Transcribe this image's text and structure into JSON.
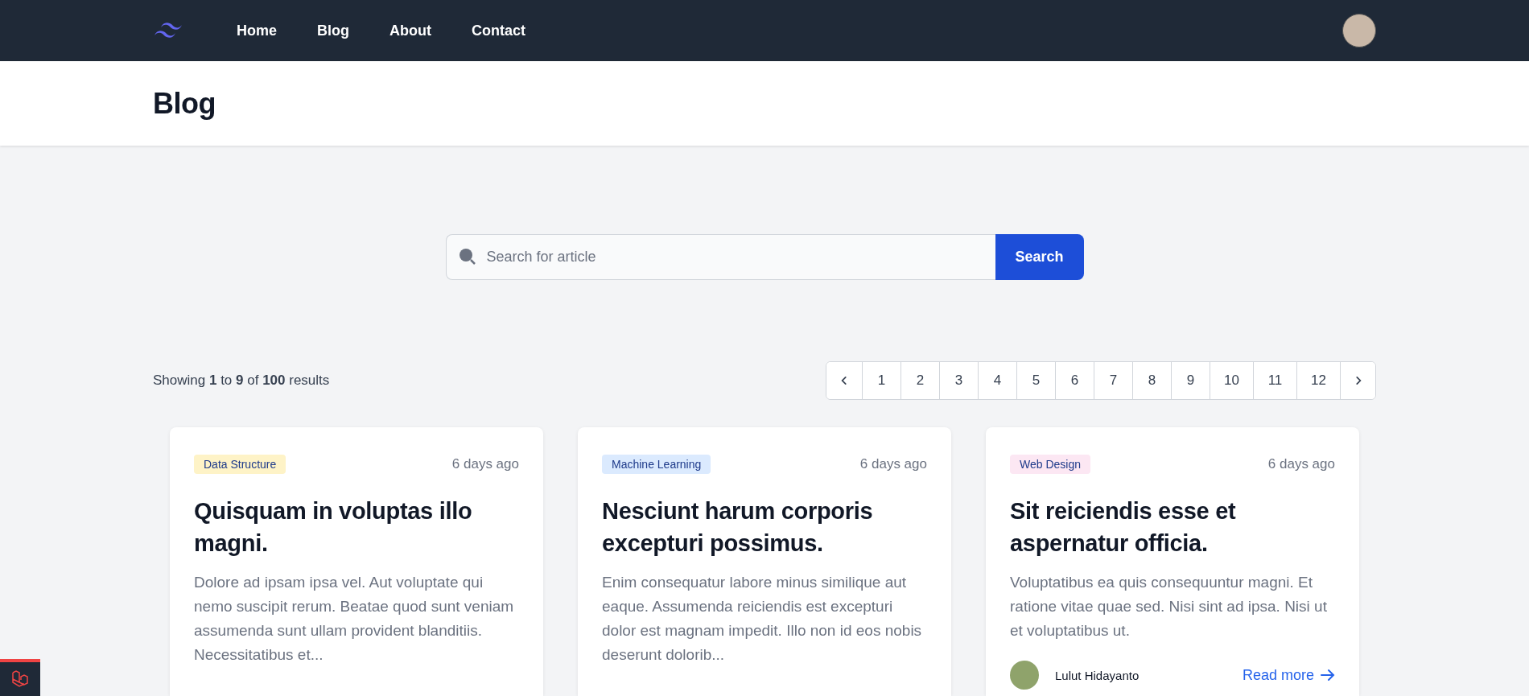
{
  "nav": {
    "links": [
      {
        "label": "Home"
      },
      {
        "label": "Blog"
      },
      {
        "label": "About"
      },
      {
        "label": "Contact"
      }
    ]
  },
  "header": {
    "title": "Blog"
  },
  "search": {
    "placeholder": "Search for article",
    "button": "Search"
  },
  "results": {
    "summary": "Showing **1** to **9** of **100** results"
  },
  "pagination": {
    "pages": [
      {
        "label": "1",
        "selected": false
      },
      {
        "label": "2",
        "selected": false
      },
      {
        "label": "3",
        "selected": false
      },
      {
        "label": "4",
        "selected": false
      },
      {
        "label": "5",
        "selected": false
      },
      {
        "label": "6",
        "selected": false
      },
      {
        "label": "7",
        "selected": false
      },
      {
        "label": "8",
        "selected": false
      },
      {
        "label": "9",
        "selected": false
      },
      {
        "label": "10",
        "selected": false
      },
      {
        "label": "11",
        "selected": false
      },
      {
        "label": "12",
        "selected": false
      }
    ]
  },
  "cards": [
    {
      "tag": "Data Structure",
      "color": "#fef3c7",
      "time": "6 days ago",
      "title": "Quisquam in voluptas illo magni.",
      "excerpt": "Dolore ad ipsam ipsa vel. Aut voluptate qui nemo suscipit rerum. Beatae quod sunt veniam assumenda sunt ullam provident blanditiis. Necessitatibus et..."
    },
    {
      "tag": "Machine Learning",
      "color": "#dbeafe",
      "time": "6 days ago",
      "title": "Nesciunt harum corporis excepturi possimus.",
      "excerpt": "Enim consequatur labore minus similique aut eaque. Assumenda reiciendis est excepturi dolor est magnam impedit. Illo non id eos nobis deserunt dolorib..."
    },
    {
      "tag": "Web Design",
      "color": "#fce7f3",
      "time": "6 days ago",
      "title": "Sit reiciendis esse et aspernatur officia.",
      "excerpt": "Voluptatibus ea quis consequuntur magni. Et ratione vitae quae sed. Nisi sint ad ipsa. Nisi ut et voluptatibus ut.",
      "author": "Lulut Hidayanto",
      "link": "Read more"
    }
  ]
}
